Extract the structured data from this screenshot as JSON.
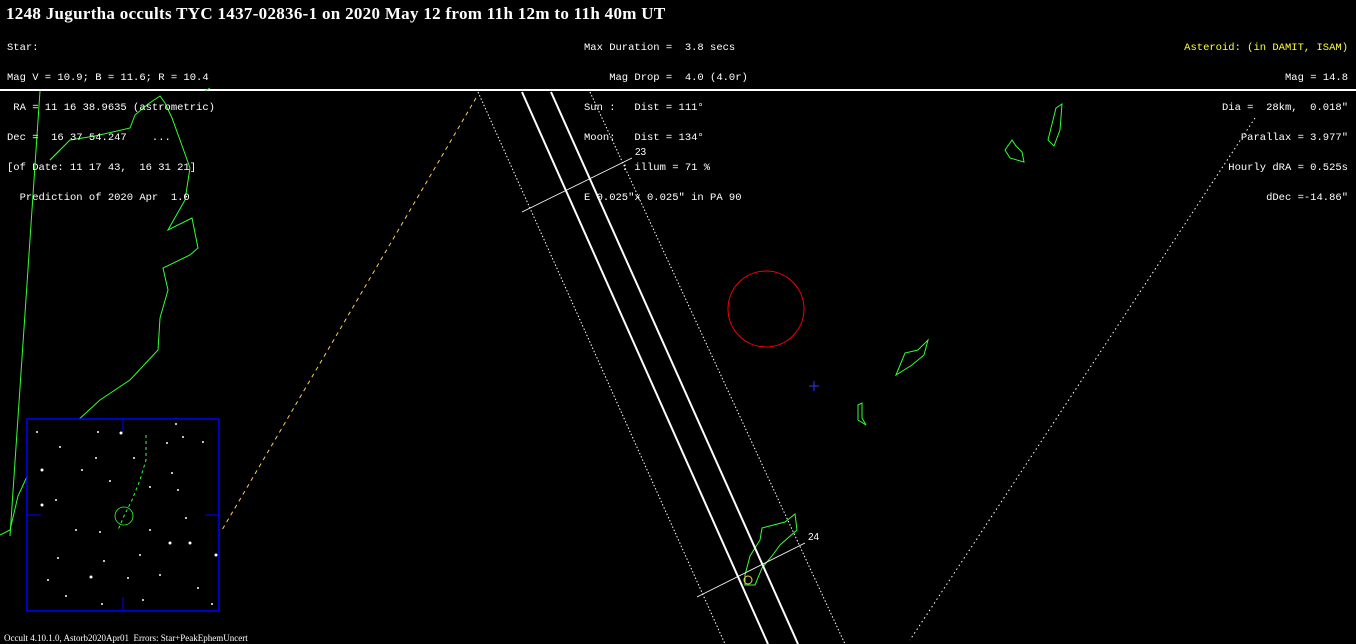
{
  "title": "1248 Jugurtha occults TYC 1437-02836-1 on 2020 May 12 from 11h 12m to 11h 40m UT",
  "star": {
    "lines": [
      "Star:",
      "Mag V = 10.9; B = 11.6; R = 10.4",
      " RA = 11 16 38.9635 (astrometric)",
      "Dec =  16 37 54.247    ...",
      "[of Date: 11 17 43,  16 31 21]",
      "  Prediction of 2020 Apr  1.0"
    ]
  },
  "event": {
    "lines": [
      "Max Duration =  3.8 secs",
      "    Mag Drop =  4.0 (4.0r)",
      "Sun :   Dist = 111°",
      "Moon:   Dist = 134°",
      "      : illum = 71 %",
      "E 0.025\"x 0.025\" in PA 90"
    ]
  },
  "asteroid": {
    "header": "Asteroid: (in DAMIT, ISAM)",
    "lines": [
      "Mag = 14.8",
      "Dia =  28km,  0.018\"",
      "Parallax = 3.977\"",
      "Hourly dRA = 0.525s",
      "dDec =-14.86\""
    ]
  },
  "time_labels": [
    "23",
    "24"
  ],
  "footer": "Occult 4.10.1.0, Astorb2020Apr01  Errors: Star+PeakEphemUncert",
  "colors": {
    "background": "#000000",
    "path": "#ffffff",
    "coastline": "#33ff33",
    "circle": "#ff0000",
    "cross": "#3333ff",
    "finder_frame": "#0000ff",
    "sun_limit": "#ffcc55",
    "asteroid_header": "#ffff33"
  },
  "icons": [
    "center-cross-icon",
    "moon-circle-icon",
    "star-field-finder"
  ]
}
